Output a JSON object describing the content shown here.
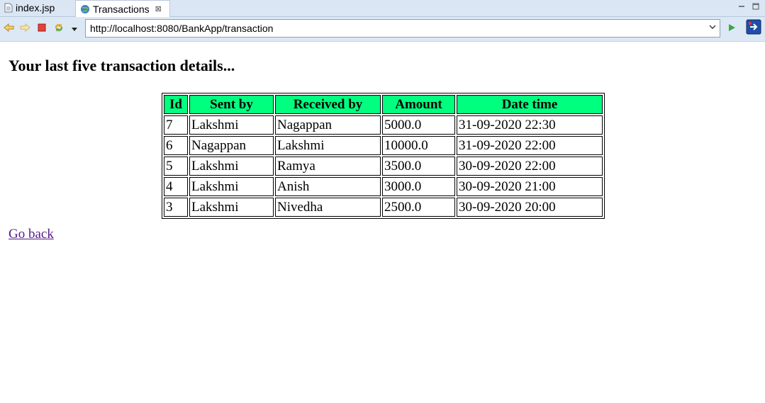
{
  "tabs": [
    {
      "label": "index.jsp",
      "icon": "jsp-file-icon",
      "active": false
    },
    {
      "label": "Transactions",
      "icon": "globe-icon",
      "active": true,
      "close": "⊠"
    }
  ],
  "toolbar": {
    "url": "http://localhost:8080/BankApp/transaction"
  },
  "page": {
    "heading": "Your last five transaction details...",
    "table": {
      "headers": [
        "Id",
        "Sent by",
        "Received by",
        "Amount",
        "Date time"
      ],
      "rows": [
        [
          "7",
          "Lakshmi",
          "Nagappan",
          "5000.0",
          "31-09-2020 22:30"
        ],
        [
          "6",
          "Nagappan",
          "Lakshmi",
          "10000.0",
          "31-09-2020 22:00"
        ],
        [
          "5",
          "Lakshmi",
          "Ramya",
          "3500.0",
          "30-09-2020 22:00"
        ],
        [
          "4",
          "Lakshmi",
          "Anish",
          "3000.0",
          "30-09-2020 21:00"
        ],
        [
          "3",
          "Lakshmi",
          "Nivedha",
          "2500.0",
          "30-09-2020 20:00"
        ]
      ]
    },
    "go_back": "Go back"
  },
  "colors": {
    "header_bg": "#00ff7f",
    "link_visited": "#551a8b",
    "chrome_bg": "#dde8f5"
  }
}
